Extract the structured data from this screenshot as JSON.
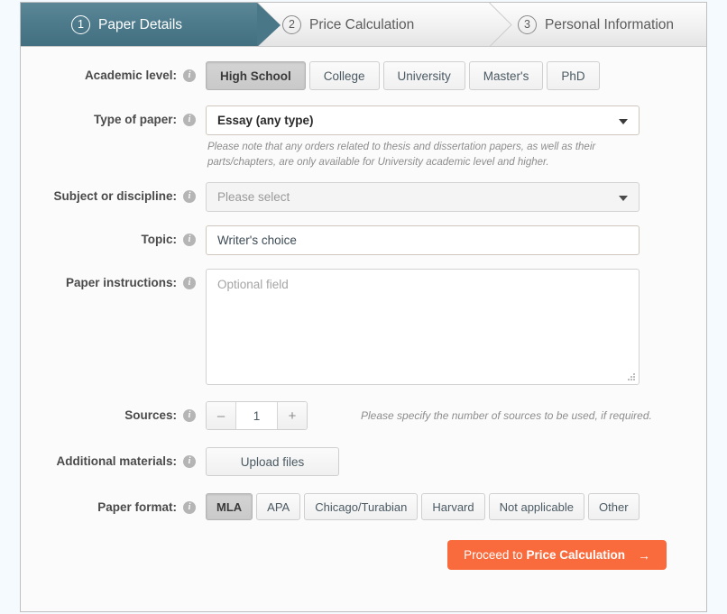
{
  "steps": [
    {
      "num": "1",
      "label": "Paper Details",
      "active": true
    },
    {
      "num": "2",
      "label": "Price Calculation",
      "active": false
    },
    {
      "num": "3",
      "label": "Personal Information",
      "active": false
    }
  ],
  "form": {
    "academic_level": {
      "label": "Academic level:",
      "info": "i",
      "options": [
        "High School",
        "College",
        "University",
        "Master's",
        "PhD"
      ],
      "selected": "High School"
    },
    "type_of_paper": {
      "label": "Type of paper:",
      "info": "i",
      "value": "Essay (any type)",
      "note": "Please note that any orders related to thesis and dissertation papers, as well as their parts/chapters, are only available for University academic level and higher."
    },
    "subject": {
      "label": "Subject or discipline:",
      "info": "i",
      "placeholder": "Please select"
    },
    "topic": {
      "label": "Topic:",
      "info": "i",
      "value": "Writer's choice"
    },
    "instructions": {
      "label": "Paper instructions:",
      "info": "i",
      "placeholder": "Optional field"
    },
    "sources": {
      "label": "Sources:",
      "info": "i",
      "minus": "–",
      "value": "1",
      "plus": "+",
      "hint": "Please specify the number of sources to be used, if required."
    },
    "additional_materials": {
      "label": "Additional materials:",
      "info": "i",
      "button": "Upload files"
    },
    "paper_format": {
      "label": "Paper format:",
      "info": "i",
      "options": [
        "MLA",
        "APA",
        "Chicago/Turabian",
        "Harvard",
        "Not applicable",
        "Other"
      ],
      "selected": "MLA"
    }
  },
  "proceed": {
    "prefix": "Proceed to",
    "target": "Price Calculation",
    "arrow": "→"
  },
  "colors": {
    "active_step": "#4a7788",
    "accent": "#f96b3c",
    "page_bg": "#f4fafd"
  }
}
